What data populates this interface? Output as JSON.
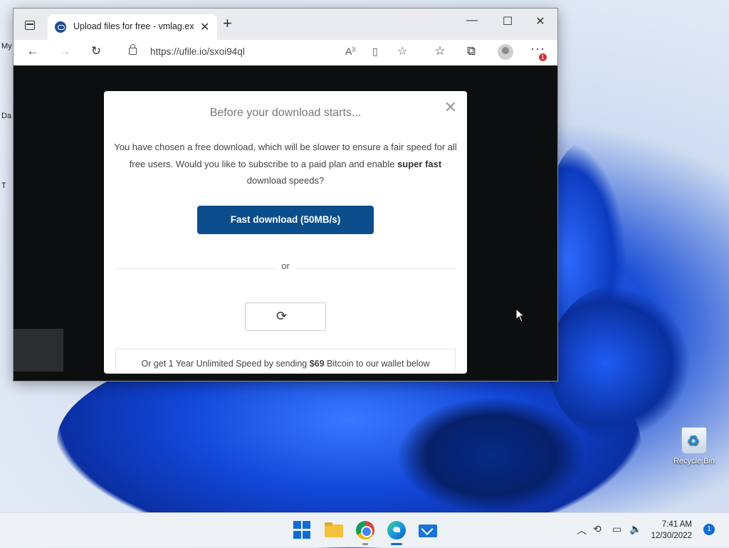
{
  "desktop": {
    "left_labels": [
      "My",
      "Da",
      "T"
    ],
    "recycle_bin_label": "Recycle Bin"
  },
  "browser": {
    "tab_title": "Upload files for free - vmlag.exe",
    "url": "https://ufile.io/sxoi94ql",
    "more_badge": "1"
  },
  "modal": {
    "title": "Before your download starts...",
    "message_part1": "You have chosen a free download, which will be slower to ensure a fair speed for all free users. Would you like to subscribe to a paid plan and enable ",
    "message_bold": "super fast",
    "message_part2": " download speeds?",
    "fast_button_label": "Fast download (50MB/s)",
    "or_label": "or",
    "bitcoin_part1": "Or get 1 Year Unlimited Speed by sending ",
    "bitcoin_amount": "$69",
    "bitcoin_part2": " Bitcoin to our wallet below"
  },
  "taskbar": {
    "time": "7:41 AM",
    "date": "12/30/2022",
    "notification_count": "1"
  },
  "colors": {
    "fast_button": "#0c4d8c",
    "accent": "#0f6cd6"
  }
}
